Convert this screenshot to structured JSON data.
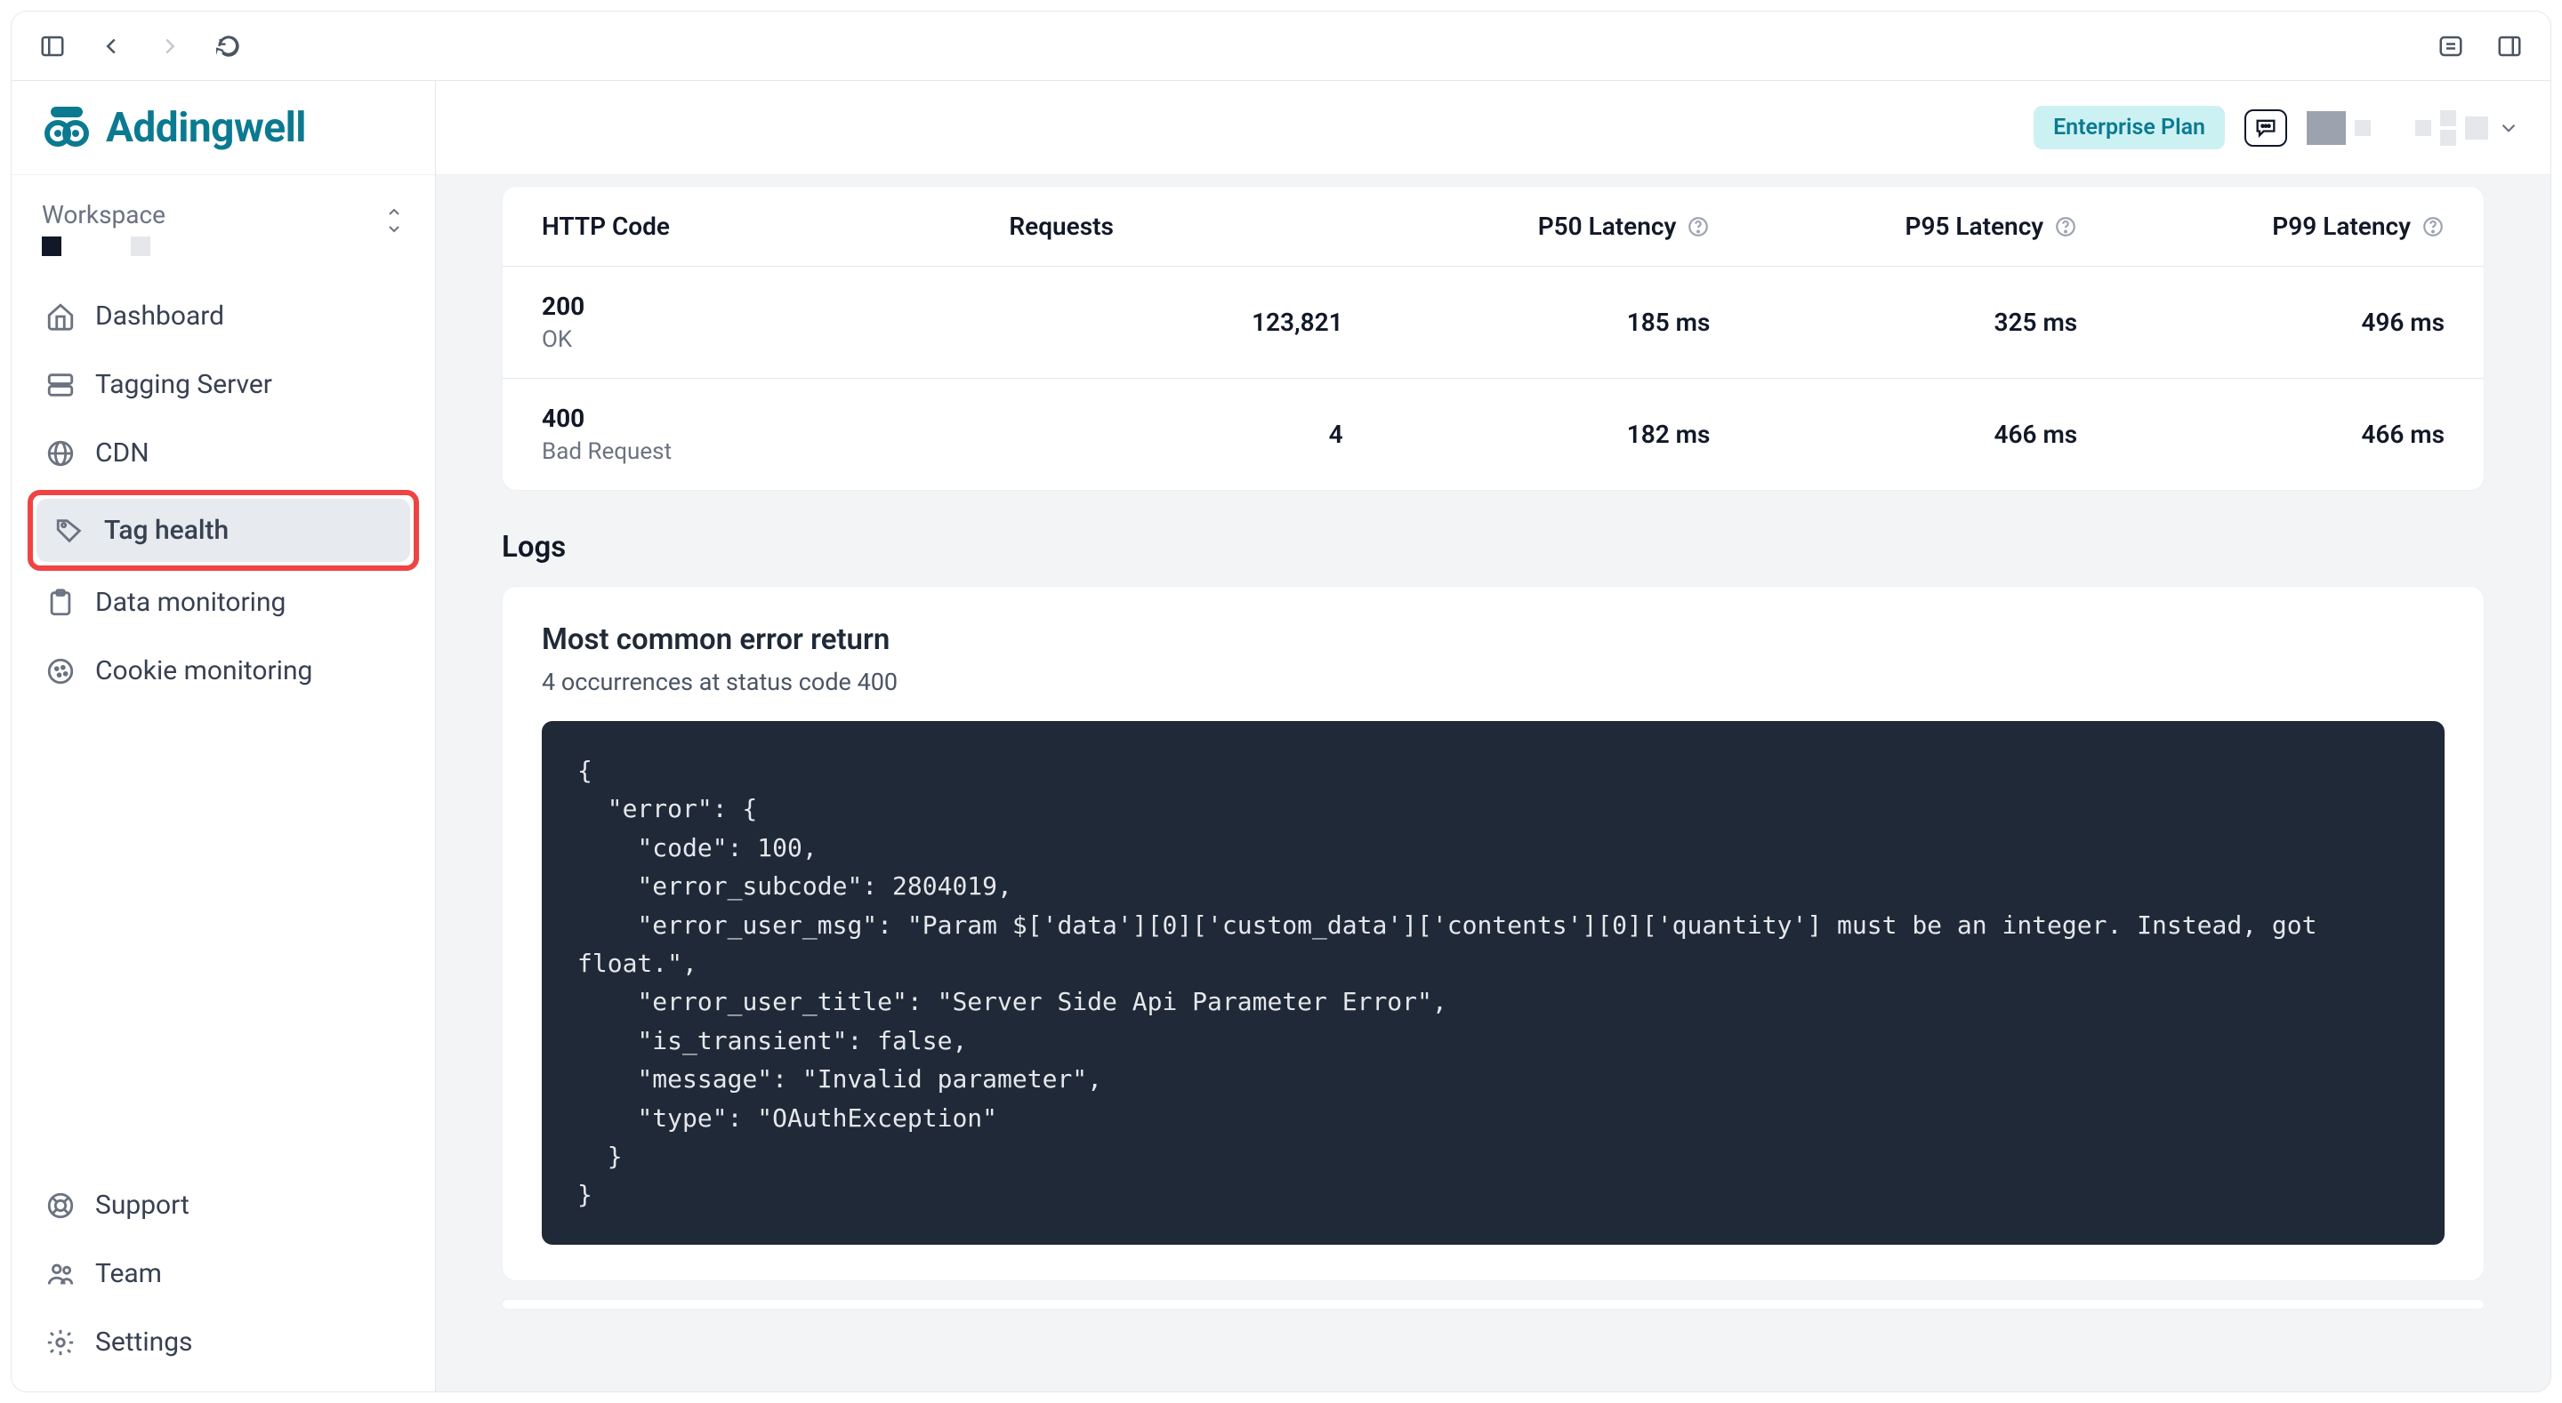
{
  "brand": "Addingwell",
  "workspace_label": "Workspace",
  "nav": {
    "dashboard": "Dashboard",
    "tagging": "Tagging Server",
    "cdn": "CDN",
    "tag_health": "Tag health",
    "data_monitoring": "Data monitoring",
    "cookie_monitoring": "Cookie monitoring",
    "support": "Support",
    "team": "Team",
    "settings": "Settings"
  },
  "header": {
    "plan_badge": "Enterprise Plan"
  },
  "status_table": {
    "headers": {
      "http_code": "HTTP Code",
      "requests": "Requests",
      "p50": "P50 Latency",
      "p95": "P95 Latency",
      "p99": "P99 Latency"
    },
    "rows": [
      {
        "code": "200",
        "desc": "OK",
        "requests": "123,821",
        "p50": "185 ms",
        "p95": "325 ms",
        "p99": "496 ms"
      },
      {
        "code": "400",
        "desc": "Bad Request",
        "requests": "4",
        "p50": "182 ms",
        "p95": "466 ms",
        "p99": "466 ms"
      }
    ]
  },
  "logs": {
    "section_title": "Logs",
    "card_title": "Most common error return",
    "subtitle": "4 occurrences at status code 400",
    "code": "{\n  \"error\": {\n    \"code\": 100,\n    \"error_subcode\": 2804019,\n    \"error_user_msg\": \"Param $['data'][0]['custom_data']['contents'][0]['quantity'] must be an integer. Instead, got float.\",\n    \"error_user_title\": \"Server Side Api Parameter Error\",\n    \"is_transient\": false,\n    \"message\": \"Invalid parameter\",\n    \"type\": \"OAuthException\"\n  }\n}"
  }
}
